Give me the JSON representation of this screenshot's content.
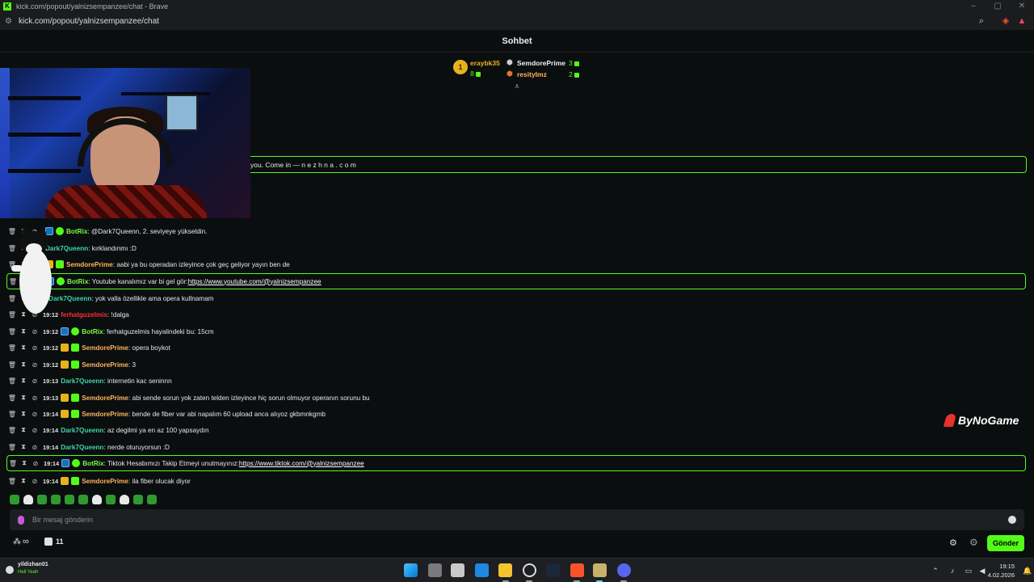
{
  "window": {
    "title": "kick.com/popout/yalnizsempanzee/chat - Brave"
  },
  "addressbar": {
    "url": "kick.com/popout/yalnizsempanzee/chat"
  },
  "chat": {
    "title": "Sohbet"
  },
  "leaderboard": {
    "rank": "1",
    "first": {
      "name": "eraybk35",
      "count": "8"
    },
    "second": {
      "name": "SemdorePrime",
      "count": "3"
    },
    "third": {
      "name": "resityImz",
      "count": "2"
    }
  },
  "pinned": {
    "text": "you. Come in — n e z h n a . c o m"
  },
  "messages": [
    {
      "ts": "",
      "user": "BotRix",
      "text": ": @Dark7Queenn, 2. seviyeye yükseldin.",
      "link": ""
    },
    {
      "ts": "",
      "user": "Dark7Queenn",
      "text": ": kırklandınmı :D",
      "link": ""
    },
    {
      "ts": "",
      "user": "SemdorePrime",
      "text": ": aabi ya bu operadan izleyince çok geç geliyor yayın ben de",
      "link": ""
    },
    {
      "ts": "",
      "user": "BotRix",
      "text": ": Youtube kanalımız var bi gel gör: ",
      "link": "https://www.youtube.com/@yalnizsempanzee"
    },
    {
      "ts": "2",
      "user": "Dark7Queenn",
      "text": ": yok valla özellikle ama opera kullnamam",
      "link": ""
    },
    {
      "ts": "19:12",
      "user": "ferhatguzelmis",
      "text": ": !dalga",
      "link": ""
    },
    {
      "ts": "19:12",
      "user": "BotRix",
      "text": ": ferhatguzelmis hayalindeki bu: 15cm",
      "link": ""
    },
    {
      "ts": "19:12",
      "user": "SemdorePrime",
      "text": ": opera boykot",
      "link": ""
    },
    {
      "ts": "19:12",
      "user": "SemdorePrime",
      "text": ": 3",
      "link": ""
    },
    {
      "ts": "19:13",
      "user": "Dark7Queenn",
      "text": ": internetin kac seninnn",
      "link": ""
    },
    {
      "ts": "19:13",
      "user": "SemdorePrime",
      "text": ": abi sende sorun yok zaten telden izleyince hiç sorun olmuyor operanın sorunu bu",
      "link": ""
    },
    {
      "ts": "19:14",
      "user": "SemdorePrime",
      "text": ": bende de fiber var abi napalım 60 upload anca alıyoz gkbmnkgmb",
      "link": ""
    },
    {
      "ts": "19:14",
      "user": "Dark7Queenn",
      "text": ": az degilmi ya en az 100 yapsaydın",
      "link": ""
    },
    {
      "ts": "19:14",
      "user": "Dark7Queenn",
      "text": ": nerde oturuyorsun :D",
      "link": ""
    },
    {
      "ts": "19:14",
      "user": "BotRix",
      "text": ": Tiktok Hesabımızı Takip Etmeyi unutmayınız: ",
      "link": "https://www.tiktok.com/@yalnizsempanzee"
    },
    {
      "ts": "19:14",
      "user": "SemdorePrime",
      "text": ": ila fiber olucak diyor",
      "link": ""
    }
  ],
  "input": {
    "placeholder": "Bir mesaj gönderin"
  },
  "footer": {
    "infinity": "∞",
    "count": "11",
    "send_label": "Gönder"
  },
  "watermark": {
    "text": "ByNoGame"
  },
  "taskbar": {
    "user": "yildizhan01",
    "status": "Hell Yeah",
    "time": "19:15",
    "date": "4.02.2026"
  },
  "colors": {
    "accent": "#53fc18",
    "background": "#0b0e0f",
    "bot": "#75fd46",
    "mod": "#ffb35c"
  }
}
